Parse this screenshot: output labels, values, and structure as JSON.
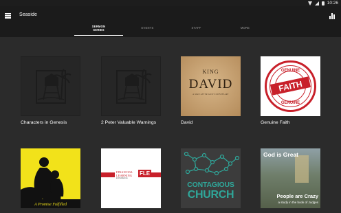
{
  "status_bar": {
    "time": "10:26",
    "icons": [
      "wifi-icon",
      "signal-icon",
      "battery-icon"
    ]
  },
  "app_bar": {
    "title": "Seaside",
    "menu_icon": "hamburger-menu-icon",
    "action_icon": "bar-chart-icon"
  },
  "tabs": [
    {
      "label": "SERMON SERIES",
      "active": true
    },
    {
      "label": "EVENTS",
      "active": false
    },
    {
      "label": "STAFF",
      "active": false
    },
    {
      "label": "MORE",
      "active": false
    }
  ],
  "series": [
    {
      "title": "Characters in Genesis"
    },
    {
      "title": "2 Peter Valuable Warnings"
    },
    {
      "title": "David",
      "art": {
        "top": "KING",
        "main": "DAVID",
        "sub": "A MAN AFTER GOD'S OWN HEART"
      }
    },
    {
      "title": "Genuine Faith",
      "art": {
        "top": "GENUINE",
        "main": "FAITH",
        "bottom": "GENUINE"
      }
    },
    {
      "title": "",
      "art": {
        "caption": "A Promise Fulfilled"
      }
    },
    {
      "title": "",
      "art": {
        "line1": "FINANCIAL",
        "line2": "LEARNING",
        "line3": "EXPERIENCE",
        "badge": "FLE"
      }
    },
    {
      "title": "",
      "art": {
        "line1": "CONTAGIOUS",
        "line2": "CHURCH"
      }
    },
    {
      "title": "",
      "art": {
        "top": "God is Great",
        "middle": "People are Crazy",
        "bottom": "a study in the book of Judges"
      }
    }
  ],
  "colors": {
    "background": "#2b2b2b",
    "app_bar": "#1b1b1b",
    "status_bar": "#1d1d1d",
    "tab_inactive": "#9a9a9a"
  }
}
